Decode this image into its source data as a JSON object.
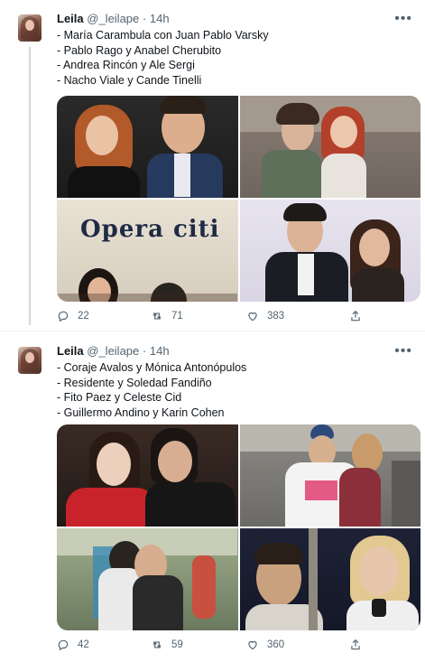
{
  "tweets": [
    {
      "author_name": "Leila",
      "handle": "@_leilape",
      "separator": "·",
      "time": "14h",
      "lines": [
        "- María Carambula con Juan Pablo Varsky",
        "- Pablo Rago y Anabel Cherubito",
        "- Andrea Rincón y Ale Sergi",
        "- Nacho Viale y Cande Tinelli"
      ],
      "photo_sign_text": "Opera citi",
      "actions": {
        "replies": "22",
        "retweets": "71",
        "likes": "383"
      }
    },
    {
      "author_name": "Leila",
      "handle": "@_leilape",
      "separator": "·",
      "time": "14h",
      "lines": [
        "- Coraje Avalos y Mónica Antonópulos",
        "- Residente y Soledad Fandiño",
        "- Fito Paez y Celeste Cid",
        "- Guillermo Andino y Karin Cohen"
      ],
      "actions": {
        "replies": "42",
        "retweets": "59",
        "likes": "360"
      }
    }
  ],
  "icons": [
    "avatar",
    "more-icon",
    "reply-icon",
    "retweet-icon",
    "like-icon",
    "share-icon"
  ],
  "colors": {
    "text": "#0f1419",
    "secondary": "#536471",
    "divider": "#eff3f4"
  }
}
